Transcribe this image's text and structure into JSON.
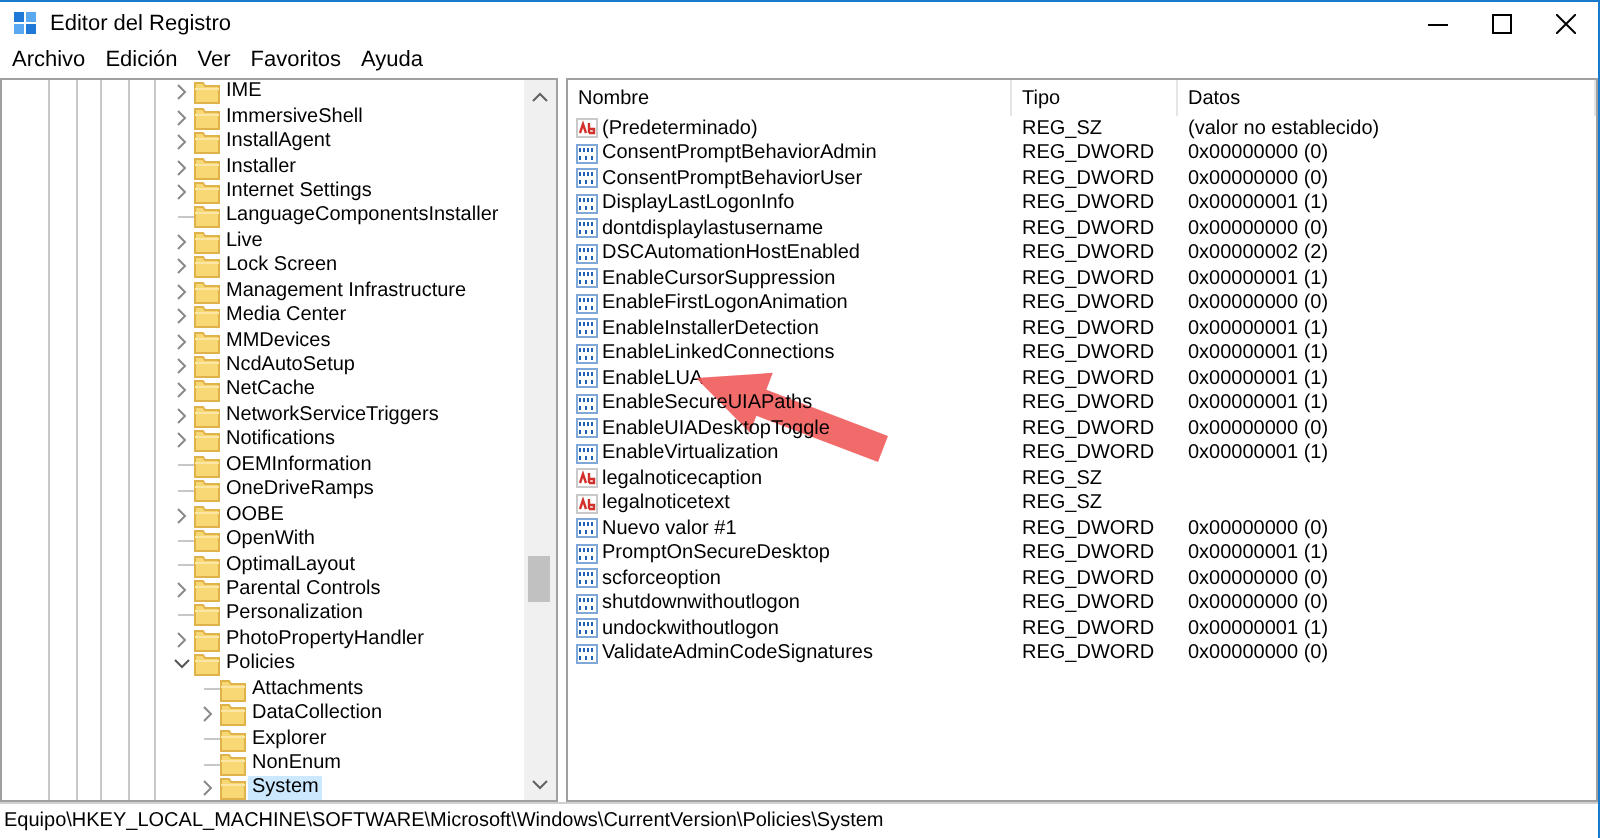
{
  "window": {
    "title": "Editor del Registro"
  },
  "menu": [
    "Archivo",
    "Edición",
    "Ver",
    "Favoritos",
    "Ayuda"
  ],
  "tree": [
    {
      "label": "IME",
      "expandable": true,
      "expanded": false,
      "selected": false
    },
    {
      "label": "ImmersiveShell",
      "expandable": true,
      "expanded": false,
      "selected": false
    },
    {
      "label": "InstallAgent",
      "expandable": true,
      "expanded": false,
      "selected": false
    },
    {
      "label": "Installer",
      "expandable": true,
      "expanded": false,
      "selected": false
    },
    {
      "label": "Internet Settings",
      "expandable": true,
      "expanded": false,
      "selected": false
    },
    {
      "label": "LanguageComponentsInstaller",
      "expandable": false,
      "selected": false
    },
    {
      "label": "Live",
      "expandable": true,
      "expanded": false,
      "selected": false
    },
    {
      "label": "Lock Screen",
      "expandable": true,
      "expanded": false,
      "selected": false
    },
    {
      "label": "Management Infrastructure",
      "expandable": true,
      "expanded": false,
      "selected": false
    },
    {
      "label": "Media Center",
      "expandable": true,
      "expanded": false,
      "selected": false
    },
    {
      "label": "MMDevices",
      "expandable": true,
      "expanded": false,
      "selected": false
    },
    {
      "label": "NcdAutoSetup",
      "expandable": true,
      "expanded": false,
      "selected": false
    },
    {
      "label": "NetCache",
      "expandable": true,
      "expanded": false,
      "selected": false
    },
    {
      "label": "NetworkServiceTriggers",
      "expandable": true,
      "expanded": false,
      "selected": false
    },
    {
      "label": "Notifications",
      "expandable": true,
      "expanded": false,
      "selected": false
    },
    {
      "label": "OEMInformation",
      "expandable": false,
      "selected": false
    },
    {
      "label": "OneDriveRamps",
      "expandable": false,
      "selected": false
    },
    {
      "label": "OOBE",
      "expandable": true,
      "expanded": false,
      "selected": false
    },
    {
      "label": "OpenWith",
      "expandable": false,
      "selected": false
    },
    {
      "label": "OptimalLayout",
      "expandable": false,
      "selected": false
    },
    {
      "label": "Parental Controls",
      "expandable": true,
      "expanded": false,
      "selected": false
    },
    {
      "label": "Personalization",
      "expandable": false,
      "selected": false
    },
    {
      "label": "PhotoPropertyHandler",
      "expandable": true,
      "expanded": false,
      "selected": false
    },
    {
      "label": "Policies",
      "expandable": true,
      "expanded": true,
      "selected": false,
      "children": [
        {
          "label": "Attachments",
          "expandable": false,
          "selected": false
        },
        {
          "label": "DataCollection",
          "expandable": true,
          "expanded": false,
          "selected": false
        },
        {
          "label": "Explorer",
          "expandable": false,
          "selected": false
        },
        {
          "label": "NonEnum",
          "expandable": false,
          "selected": false
        },
        {
          "label": "System",
          "expandable": true,
          "expanded": false,
          "selected": true
        }
      ]
    }
  ],
  "list": {
    "columns": [
      "Nombre",
      "Tipo",
      "Datos"
    ],
    "rows": [
      {
        "kind": "sz",
        "name": "(Predeterminado)",
        "type": "REG_SZ",
        "data": "(valor no establecido)"
      },
      {
        "kind": "dword",
        "name": "ConsentPromptBehaviorAdmin",
        "type": "REG_DWORD",
        "data": "0x00000000 (0)"
      },
      {
        "kind": "dword",
        "name": "ConsentPromptBehaviorUser",
        "type": "REG_DWORD",
        "data": "0x00000000 (0)"
      },
      {
        "kind": "dword",
        "name": "DisplayLastLogonInfo",
        "type": "REG_DWORD",
        "data": "0x00000001 (1)"
      },
      {
        "kind": "dword",
        "name": "dontdisplaylastusername",
        "type": "REG_DWORD",
        "data": "0x00000000 (0)"
      },
      {
        "kind": "dword",
        "name": "DSCAutomationHostEnabled",
        "type": "REG_DWORD",
        "data": "0x00000002 (2)"
      },
      {
        "kind": "dword",
        "name": "EnableCursorSuppression",
        "type": "REG_DWORD",
        "data": "0x00000001 (1)"
      },
      {
        "kind": "dword",
        "name": "EnableFirstLogonAnimation",
        "type": "REG_DWORD",
        "data": "0x00000000 (0)"
      },
      {
        "kind": "dword",
        "name": "EnableInstallerDetection",
        "type": "REG_DWORD",
        "data": "0x00000001 (1)"
      },
      {
        "kind": "dword",
        "name": "EnableLinkedConnections",
        "type": "REG_DWORD",
        "data": "0x00000001 (1)"
      },
      {
        "kind": "dword",
        "name": "EnableLUA",
        "type": "REG_DWORD",
        "data": "0x00000001 (1)",
        "arrow": true
      },
      {
        "kind": "dword",
        "name": "EnableSecureUIAPaths",
        "type": "REG_DWORD",
        "data": "0x00000001 (1)"
      },
      {
        "kind": "dword",
        "name": "EnableUIADesktopToggle",
        "type": "REG_DWORD",
        "data": "0x00000000 (0)"
      },
      {
        "kind": "dword",
        "name": "EnableVirtualization",
        "type": "REG_DWORD",
        "data": "0x00000001 (1)"
      },
      {
        "kind": "sz",
        "name": "legalnoticecaption",
        "type": "REG_SZ"
      },
      {
        "kind": "sz",
        "name": "legalnoticetext",
        "type": "REG_SZ"
      },
      {
        "kind": "dword",
        "name": "Nuevo valor #1",
        "type": "REG_DWORD",
        "data": "0x00000000 (0)"
      },
      {
        "kind": "dword",
        "name": "PromptOnSecureDesktop",
        "type": "REG_DWORD",
        "data": "0x00000001 (1)"
      },
      {
        "kind": "dword",
        "name": "scforceoption",
        "type": "REG_DWORD",
        "data": "0x00000000 (0)"
      },
      {
        "kind": "dword",
        "name": "shutdownwithoutlogon",
        "type": "REG_DWORD",
        "data": "0x00000000 (0)"
      },
      {
        "kind": "dword",
        "name": "undockwithoutlogon",
        "type": "REG_DWORD",
        "data": "0x00000001 (1)"
      },
      {
        "kind": "dword",
        "name": "ValidateAdminCodeSignatures",
        "type": "REG_DWORD",
        "data": "0x00000000 (0)"
      }
    ]
  },
  "status_bar": "Equipo\\HKEY_LOCAL_MACHINE\\SOFTWARE\\Microsoft\\Windows\\CurrentVersion\\Policies\\System"
}
